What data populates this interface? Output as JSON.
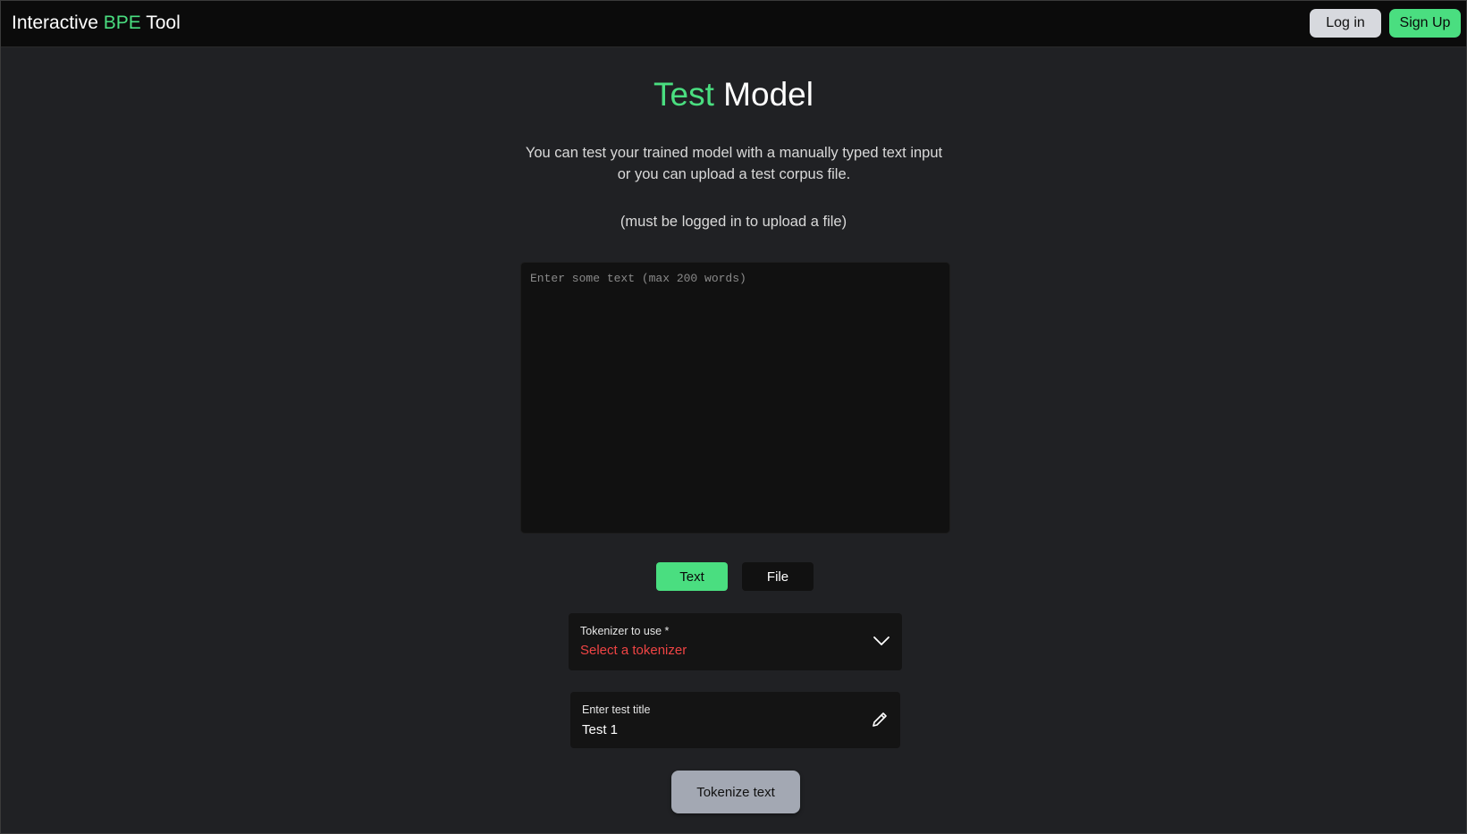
{
  "header": {
    "brand_prefix": "Interactive ",
    "brand_accent": "BPE",
    "brand_suffix": " Tool",
    "login_label": "Log in",
    "signup_label": "Sign Up"
  },
  "main": {
    "title_accent": "Test",
    "title_rest": " Model",
    "description_line1": "You can test your trained model with a manually typed text input",
    "description_line2": "or you can upload a test corpus file.",
    "login_note": "(must be logged in to upload a file)",
    "textarea": {
      "value": "",
      "placeholder": "Enter some text (max 200 words)"
    },
    "modes": {
      "text_label": "Text",
      "file_label": "File",
      "selected": "Text"
    },
    "tokenizer_select": {
      "label": "Tokenizer to use *",
      "value": "Select a tokenizer"
    },
    "test_title": {
      "label": "Enter test title",
      "value": "Test 1"
    },
    "submit_label": "Tokenize text"
  },
  "icons": {
    "select_icon": "chevron-down-icon",
    "title_icon": "pencil-icon"
  },
  "colors": {
    "accent": "#4ade80",
    "error": "#ef4444",
    "background": "#202124",
    "navbar": "#0b0b0b"
  }
}
